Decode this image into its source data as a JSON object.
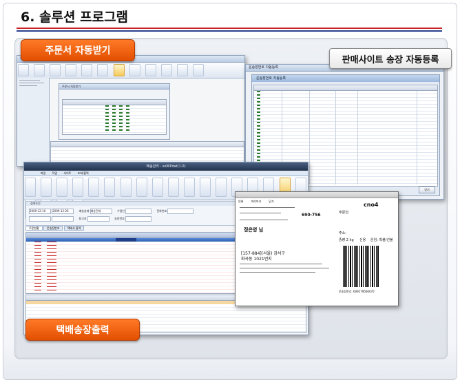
{
  "page": {
    "title": "6. 솔루션 프로그램"
  },
  "badges": {
    "order_receive": "주문서 자동받기",
    "invoice_register": "판매사이트 송장 자동등록",
    "courier_print": "택배송장출력"
  },
  "colors": {
    "accent_orange": "#e55a0a",
    "rule_red": "#cc2222",
    "rule_blue": "#2a3f8f",
    "window_chrome": "#8fa2bd"
  },
  "window_main": {
    "window_title": "배송관리 - soWPdat(1.0)",
    "tabs": [
      "파일",
      "작업",
      "사이트",
      "조회/출력"
    ],
    "panel_title": "검색조건",
    "filters": {
      "date_from": "2009-12-10",
      "date_to": "2009-12-26",
      "site_label": "배송상태",
      "site_value": "배송전체",
      "receiver_label": "수령인",
      "phone_label": "전화번호",
      "warehouse_label": "창고지",
      "invoice_label": "송장번호"
    },
    "tab_labels": [
      "주문현황",
      "운송장번호",
      "택배사 출력"
    ],
    "columns": [
      "번호",
      "주문번호",
      "P",
      "S",
      "배송상태",
      "운송장번호",
      "택배사",
      "결제구분",
      "배송일",
      "주문일시",
      "판매사",
      "배송지",
      "우편번호"
    ],
    "lower_columns": [
      "No",
      "주문번호",
      "주문구분",
      "주문번호",
      "상품코드",
      "상품명",
      "수량",
      "판매가",
      "결제금액",
      "배송지",
      "전화번호"
    ]
  },
  "window_order": {
    "window_title": "주문서 자동받기",
    "inner_title": "주문서 자동받기",
    "columns": [
      "주문번호",
      "상품번호",
      "주문자",
      "등록",
      "전송",
      "배송",
      "상태",
      "주문일시",
      "수량",
      "판매사",
      "가격"
    ]
  },
  "window_invoice": {
    "window_title": "운송장번호 자동등록",
    "inner_title": "운송장번호 자동등록",
    "columns": [
      "선택",
      "판매사",
      "주문번호",
      "운송장번호",
      "수정",
      "수령인",
      "주문자",
      "상품명",
      "결제금액",
      "수량"
    ],
    "footer_button": "닫기"
  },
  "label_card": {
    "print_buttons": [
      "인쇄",
      "미리보기",
      "닫기"
    ],
    "logo": "cno4",
    "sender_title": "주문인:",
    "receiver_name": "정은영 님",
    "postal": "690-756",
    "phone_label": "주소:",
    "weight": "중량 2 kg",
    "payment": "신용",
    "fee_label": "운임: 착불/선불",
    "address_line1": "[157-884](서울) 강서구",
    "address_line2": "화곡동 1021번지",
    "invoice_number": "운송장번호: 609279566070"
  }
}
